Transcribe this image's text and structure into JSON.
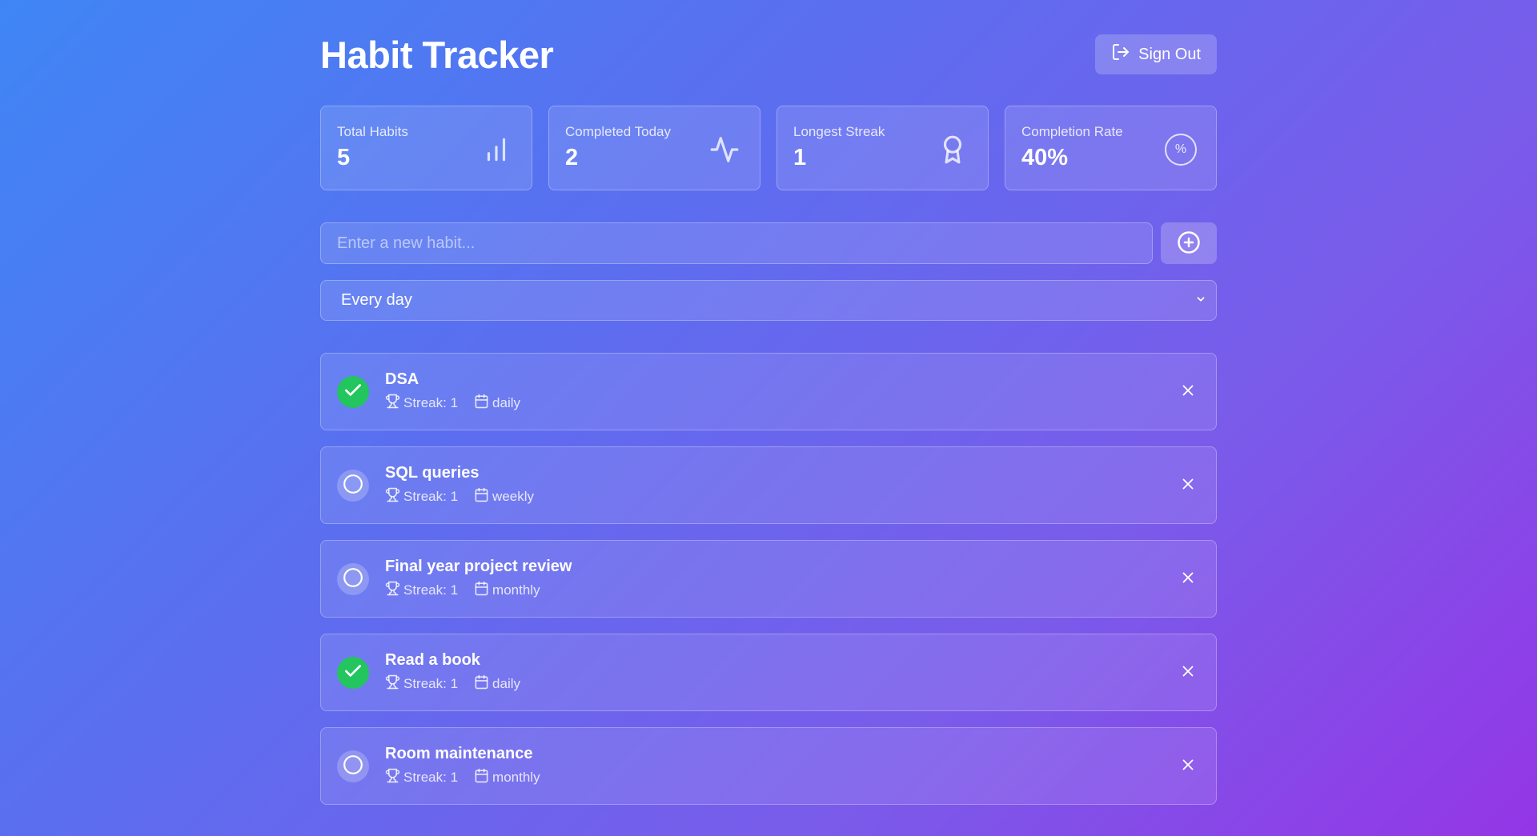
{
  "header": {
    "title": "Habit Tracker",
    "signout_label": "Sign Out",
    "signout_icon": "log-out-icon"
  },
  "stats": [
    {
      "label": "Total Habits",
      "value": "5",
      "icon": "bar-chart-icon"
    },
    {
      "label": "Completed Today",
      "value": "2",
      "icon": "activity-icon"
    },
    {
      "label": "Longest Streak",
      "value": "1",
      "icon": "award-icon"
    },
    {
      "label": "Completion Rate",
      "value": "40%",
      "icon": "percent-icon",
      "icon_text": "%"
    }
  ],
  "add_habit": {
    "placeholder": "Enter a new habit...",
    "value": "",
    "button_icon": "plus-circle-icon"
  },
  "frequency_select": {
    "selected": "Every day"
  },
  "habits": [
    {
      "name": "DSA",
      "completed": true,
      "streak": "Streak: 1",
      "frequency": "daily"
    },
    {
      "name": "SQL queries",
      "completed": false,
      "streak": "Streak: 1",
      "frequency": "weekly"
    },
    {
      "name": "Final year project review",
      "completed": false,
      "streak": "Streak: 1",
      "frequency": "monthly"
    },
    {
      "name": "Read a book",
      "completed": true,
      "streak": "Streak: 1",
      "frequency": "daily"
    },
    {
      "name": "Room maintenance",
      "completed": false,
      "streak": "Streak: 1",
      "frequency": "monthly"
    }
  ],
  "colors": {
    "completed_green": "#22c55e",
    "gradient_start": "#3f86f5",
    "gradient_end": "#9436e6"
  }
}
